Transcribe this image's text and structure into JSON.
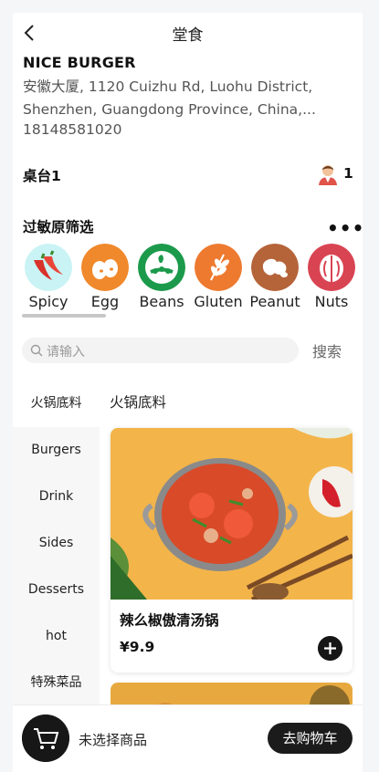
{
  "header": {
    "title": "堂食",
    "back_icon": "back-chevron-icon"
  },
  "store": {
    "name": "NICE BURGER",
    "address": "安徽大厦, 1120 Cuizhu Rd, Luohu District, Shenzhen, Guangdong Province, China,...",
    "phone": "18148581020"
  },
  "table": {
    "label": "桌台1",
    "diner_count": "1",
    "avatar_icon": "diner-avatar-icon"
  },
  "allergen": {
    "title": "过敏原筛选",
    "more": "•••",
    "items": [
      {
        "name": "Spicy",
        "icon": "chili-pepper-icon",
        "color": "#c9f3f4"
      },
      {
        "name": "Egg",
        "icon": "egg-icon",
        "color": "#f0892b"
      },
      {
        "name": "Beans",
        "icon": "beans-icon",
        "color": "#1c9a4c"
      },
      {
        "name": "Gluten",
        "icon": "wheat-icon",
        "color": "#ee7a30"
      },
      {
        "name": "Peanut",
        "icon": "peanut-icon",
        "color": "#b5643a"
      },
      {
        "name": "Nuts",
        "icon": "walnut-icon",
        "color": "#d94453"
      }
    ]
  },
  "search": {
    "placeholder": "请输入",
    "button_label": "搜索"
  },
  "categories": [
    {
      "label": "火锅底料",
      "active": true
    },
    {
      "label": "Burgers"
    },
    {
      "label": "Drink"
    },
    {
      "label": "Sides"
    },
    {
      "label": "Desserts"
    },
    {
      "label": "hot"
    },
    {
      "label": "特殊菜品"
    }
  ],
  "menu": {
    "section_title": "火锅底料",
    "dishes": [
      {
        "name": "辣么椒傲清汤锅",
        "price": "¥9.9"
      }
    ]
  },
  "cart": {
    "status": "未选择商品",
    "checkout_label": "去购物车",
    "icon": "shopping-cart-icon"
  },
  "colors": {
    "primary": "#171717",
    "background": "#f5f6f8",
    "category_bg": "#f7f7f7"
  }
}
